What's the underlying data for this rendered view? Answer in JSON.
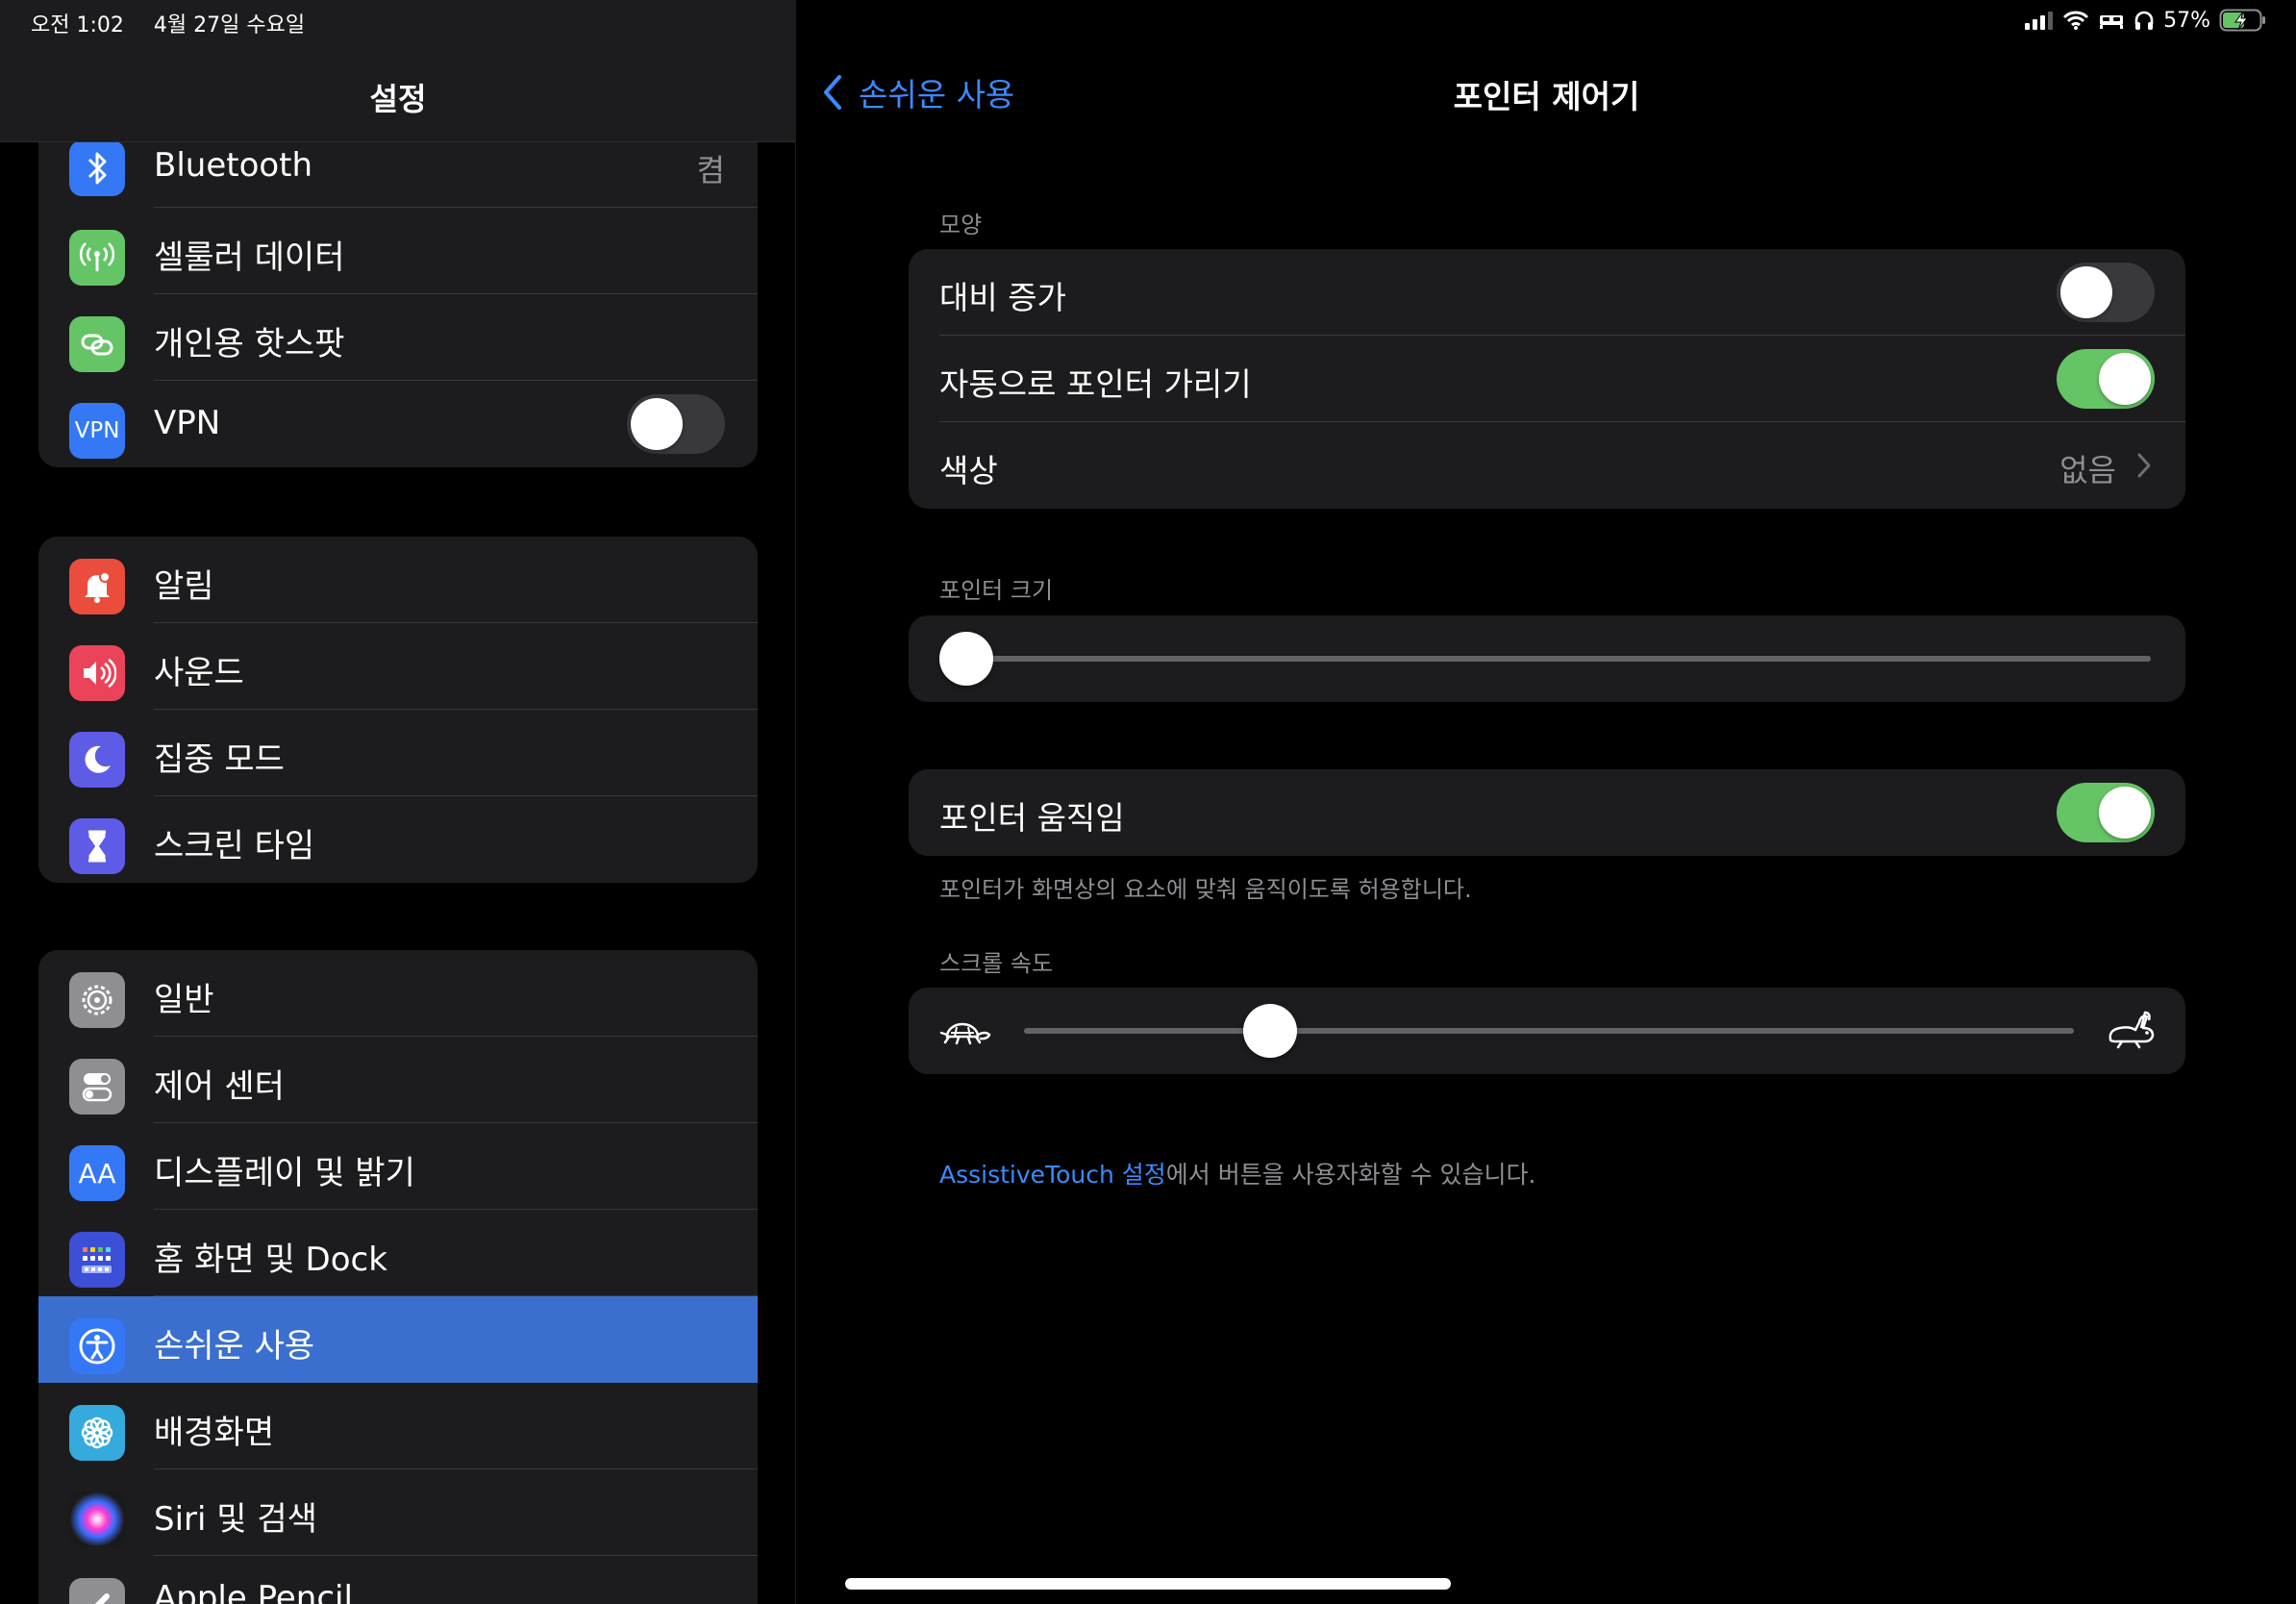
{
  "status": {
    "time": "오전 1:02",
    "date": "4월 27일 수요일",
    "battery": "57%"
  },
  "sidebar": {
    "title": "설정",
    "group1": [
      {
        "label": "Bluetooth",
        "value": "켬",
        "icon": "bluetooth-icon",
        "color": "#3478f6"
      },
      {
        "label": "셀룰러 데이터",
        "icon": "antenna-icon",
        "color": "#65c466"
      },
      {
        "label": "개인용 핫스팟",
        "icon": "hotspot-link-icon",
        "color": "#65c466"
      },
      {
        "label": "VPN",
        "icon": "vpn-icon",
        "icon_text": "VPN",
        "color": "#3478f6",
        "toggle": false
      }
    ],
    "group2": [
      {
        "label": "알림",
        "icon": "bell-icon",
        "color": "#eb4d3d"
      },
      {
        "label": "사운드",
        "icon": "speaker-icon",
        "color": "#eb445a"
      },
      {
        "label": "집중 모드",
        "icon": "moon-icon",
        "color": "#5e5ce6"
      },
      {
        "label": "스크린 타임",
        "icon": "hourglass-icon",
        "color": "#5e5ce6"
      }
    ],
    "group3": [
      {
        "label": "일반",
        "icon": "gear-icon",
        "color": "#8e8e93"
      },
      {
        "label": "제어 센터",
        "icon": "switches-icon",
        "color": "#8e8e93"
      },
      {
        "label": "디스플레이 및 밝기",
        "icon": "text-size-icon",
        "icon_text": "AA",
        "color": "#3478f6"
      },
      {
        "label": "홈 화면 및 Dock",
        "icon": "home-grid-icon",
        "color": "#3478f6"
      },
      {
        "label": "손쉬운 사용",
        "icon": "accessibility-icon",
        "color": "#3478f6",
        "selected": true
      },
      {
        "label": "배경화면",
        "icon": "flower-icon",
        "color": "#35aadc"
      },
      {
        "label": "Siri 및 검색",
        "icon": "siri-icon",
        "color": "#222"
      },
      {
        "label": "Apple Pencil",
        "icon": "pencil-icon",
        "color": "#8e8e93"
      }
    ]
  },
  "detail": {
    "back_label": "손쉬운 사용",
    "title": "포인터 제어기",
    "appearance_header": "모양",
    "increase_contrast": "대비 증가",
    "increase_contrast_on": false,
    "auto_hide": "자동으로 포인터 가리기",
    "auto_hide_on": true,
    "color_label": "색상",
    "color_value": "없음",
    "pointer_size_header": "포인터 크기",
    "pointer_size_value": 0,
    "pointer_animations": "포인터 움직임",
    "pointer_animations_on": true,
    "pointer_animations_footer": "포인터가 화면상의 요소에 맞춰 움직이도록 허용합니다.",
    "scroll_speed_header": "스크롤 속도",
    "scroll_speed_value": 0.23,
    "assistive_link": "AssistiveTouch 설정",
    "assistive_rest": "에서 버튼을 사용자화할 수 있습니다."
  }
}
